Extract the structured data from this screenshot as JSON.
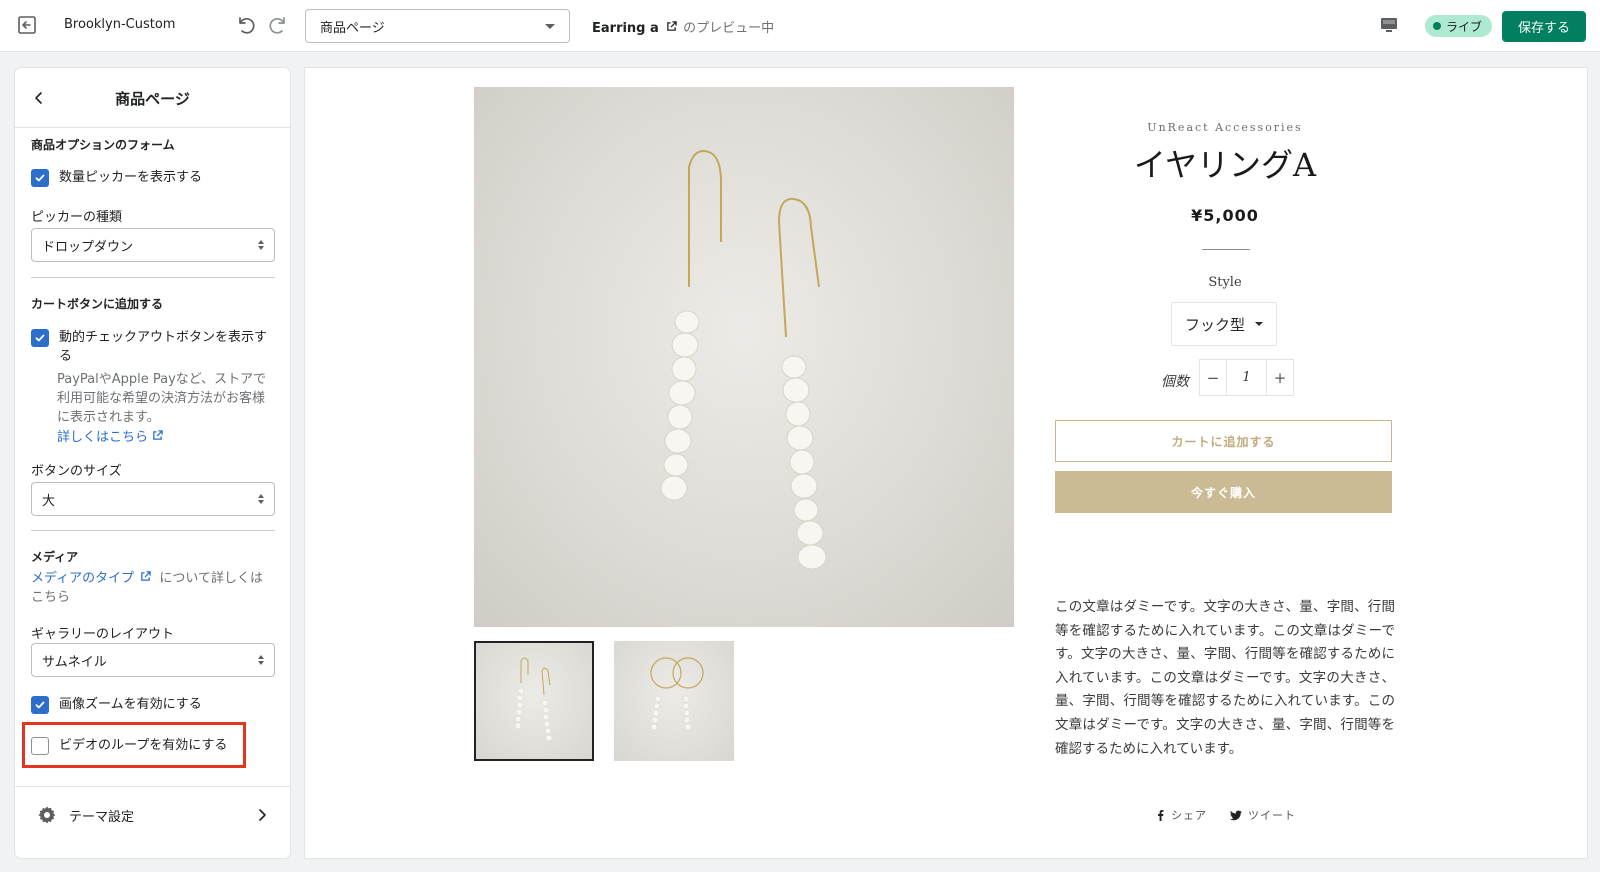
{
  "topbar": {
    "store_name": "Brooklyn-Custom",
    "page_select": "商品ページ",
    "preview_product": "Earring a",
    "preview_suffix": "のプレビュー中",
    "live_badge": "ライブ",
    "save_label": "保存する"
  },
  "sidebar": {
    "title": "商品ページ",
    "form_section": {
      "title": "商品オプションのフォーム",
      "qty_picker_label": "数量ピッカーを表示する",
      "qty_picker_checked": true,
      "picker_type_label": "ピッカーの種類",
      "picker_type_value": "ドロップダウン"
    },
    "cart_section": {
      "title": "カートボタンに追加する",
      "dynamic_checkout_label": "動的チェックアウトボタンを表示する",
      "dynamic_checkout_checked": true,
      "dynamic_checkout_help": "PayPalやApple Payなど、ストアで利用可能な希望の決済方法がお客様に表示されます。",
      "learn_more": "詳しくはこちら",
      "button_size_label": "ボタンのサイズ",
      "button_size_value": "大"
    },
    "media_section": {
      "title": "メディア",
      "media_type_link": "メディアのタイプ",
      "media_type_suffix": "について詳しくはこちら",
      "gallery_layout_label": "ギャラリーのレイアウト",
      "gallery_layout_value": "サムネイル",
      "image_zoom_label": "画像ズームを有効にする",
      "image_zoom_checked": true,
      "video_loop_label": "ビデオのループを有効にする",
      "video_loop_checked": false
    },
    "theme_settings_label": "テーマ設定"
  },
  "product": {
    "brand": "UnReact Accessories",
    "title": "イヤリングA",
    "price": "¥5,000",
    "style_label": "Style",
    "style_value": "フック型",
    "qty_label": "個数",
    "qty_value": "1",
    "add_to_cart": "カートに追加する",
    "buy_now": "今すぐ購入",
    "description": "この文章はダミーです。文字の大きさ、量、字間、行間等を確認するために入れています。この文章はダミーです。文字の大きさ、量、字間、行間等を確認するために入れています。この文章はダミーです。文字の大きさ、量、字間、行間等を確認するために入れています。この文章はダミーです。文字の大きさ、量、字間、行間等を確認するために入れています。",
    "share_label": "シェア",
    "tweet_label": "ツイート"
  },
  "colors": {
    "accent": "#2c6ecb",
    "save_button": "#008060",
    "live_badge_bg": "#aee9d1",
    "highlight_border": "#e5341f",
    "buy_now_bg": "#cbbb95"
  },
  "icons": {
    "exit": "exit-icon",
    "undo": "undo-icon",
    "redo": "redo-icon",
    "device": "desktop-icon",
    "back": "chevron-left-icon",
    "external": "external-link-icon",
    "settings": "gear-icon",
    "forward": "chevron-right-icon",
    "facebook": "facebook-icon",
    "twitter": "twitter-icon"
  }
}
